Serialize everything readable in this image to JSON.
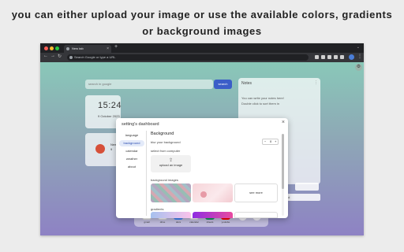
{
  "caption": {
    "line1": "you can either upload your image or use the available colors, gradients",
    "line2": "or background images"
  },
  "browser": {
    "tab_title": "New tab",
    "tab_close": "×",
    "new_tab": "+",
    "tab_list": "⌄",
    "nav_back": "←",
    "nav_forward": "→",
    "nav_reload": "↻",
    "address_placeholder": "Search Google or type a URL",
    "menu": "⋮"
  },
  "dashboard": {
    "corner_button": "⚙",
    "search_placeholder": "search in google",
    "search_button": "search",
    "clock_time": "15:24",
    "clock_date": "9 October 2023",
    "weather_line1": "New",
    "weather_line2": "9",
    "notes_title": "Notes",
    "notes_menu": "⋮",
    "notes_lines": [
      "You can write your notes here!",
      "Double click to sort them in"
    ],
    "notes_green": "done",
    "notes_bottom": "add",
    "dock_apps": [
      {
        "label": "gmail",
        "glyph": "M",
        "color": "#ea4335"
      },
      {
        "label": "drive",
        "glyph": "▲",
        "color": "#34a853"
      },
      {
        "label": "docs",
        "glyph": "≡",
        "color": "#4285f4"
      },
      {
        "label": "calendar",
        "glyph": "31",
        "color": "#4285f4"
      },
      {
        "label": "sheets",
        "glyph": "⊞",
        "color": "#0f9d58"
      },
      {
        "label": "youtube",
        "glyph": "▶",
        "color": "#ff0000"
      }
    ],
    "dock_add": "+",
    "dock_edit": "✎"
  },
  "settings": {
    "title": "setting's dashboard",
    "close": "×",
    "nav": [
      "language",
      "background",
      "calendar",
      "weather",
      "about"
    ],
    "active_nav": "background",
    "section_title": "Background",
    "blur_label": "blur your background",
    "blur_minus": "−",
    "blur_value": "0",
    "blur_plus": "+",
    "select_label": "select from computer",
    "upload_icon": "⇪",
    "upload_label": "upload an image",
    "bg_images_label": "background images",
    "see_more": "see more",
    "gradients_label": "gradients"
  }
}
